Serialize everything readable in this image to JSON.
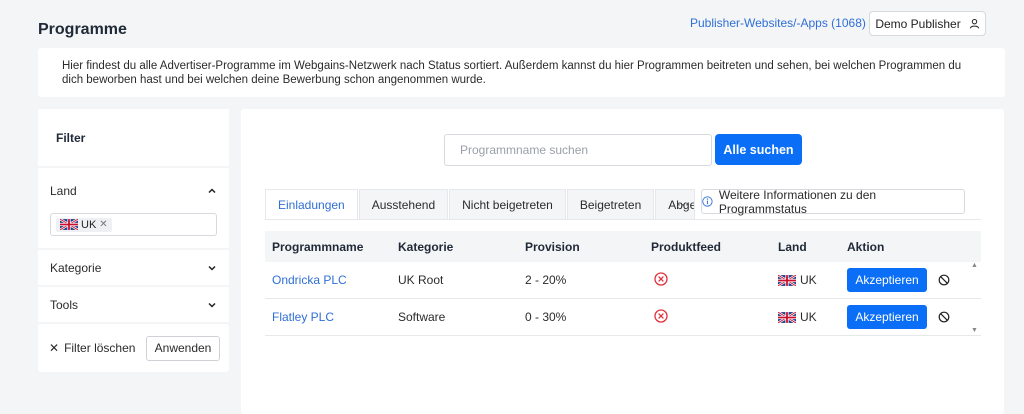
{
  "header": {
    "title": "Programme",
    "publisher_link": "Publisher-Websites/-Apps (1068)",
    "account_label": "Demo Publisher"
  },
  "intro": {
    "text": "Hier findest du alle Advertiser-Programme im Webgains-Netzwerk nach Status sortiert. Außerdem kannst du hier Programmen beitreten und sehen, bei welchen Programmen du dich beworben hast und bei welchen deine Bewerbung schon angenommen wurde."
  },
  "filter": {
    "title": "Filter",
    "land_label": "Land",
    "selected_country": "UK",
    "kategorie_label": "Kategorie",
    "tools_label": "Tools",
    "clear_label": "Filter löschen",
    "apply_label": "Anwenden"
  },
  "search": {
    "placeholder": "Programmname suchen",
    "button_label": "Alle suchen"
  },
  "tabs": [
    {
      "label": "Einladungen"
    },
    {
      "label": "Ausstehend"
    },
    {
      "label": "Nicht beigetreten"
    },
    {
      "label": "Beigetreten"
    },
    {
      "label": "Abge"
    }
  ],
  "more_tabs_label": "···",
  "info_button_label": "Weitere Informationen zu den Programmstatus",
  "table": {
    "columns": [
      "Programmname",
      "Kategorie",
      "Provision",
      "Produktfeed",
      "Land",
      "Aktion"
    ],
    "rows": [
      {
        "name": "Ondricka PLC",
        "category": "UK Root",
        "commission": "2 - 20%",
        "country": "UK",
        "action": "Akzeptieren"
      },
      {
        "name": "Flatley PLC",
        "category": "Software",
        "commission": "0 - 30%",
        "country": "UK",
        "action": "Akzeptieren"
      }
    ]
  },
  "colors": {
    "accent": "#0b6ef6",
    "link": "#2f6fd6",
    "error_icon": "#e0313a",
    "background": "#f4f5f7"
  }
}
